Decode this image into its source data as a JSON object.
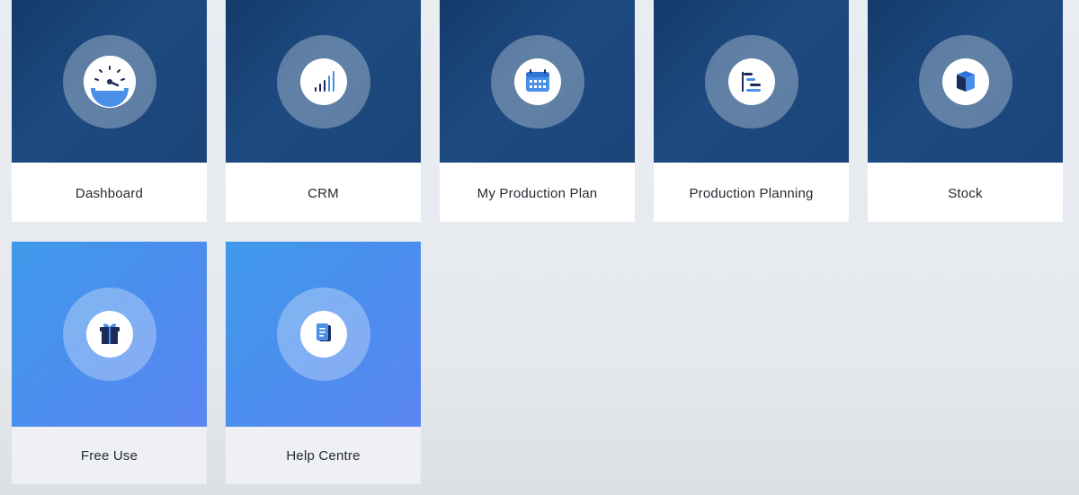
{
  "tiles_row1": [
    {
      "label": "Dashboard",
      "icon": "speedometer-icon"
    },
    {
      "label": "CRM",
      "icon": "signal-bars-icon"
    },
    {
      "label": "My Production Plan",
      "icon": "calendar-icon"
    },
    {
      "label": "Production Planning",
      "icon": "gantt-icon"
    },
    {
      "label": "Stock",
      "icon": "box-icon"
    }
  ],
  "tiles_row2": [
    {
      "label": "Free Use",
      "icon": "gift-icon"
    },
    {
      "label": "Help Centre",
      "icon": "document-icon"
    }
  ],
  "colors": {
    "dark_tile": "#1d4a80",
    "light_tile": "#4d8def",
    "icon_navy": "#1e2a5a",
    "icon_blue": "#4a8fe8"
  }
}
